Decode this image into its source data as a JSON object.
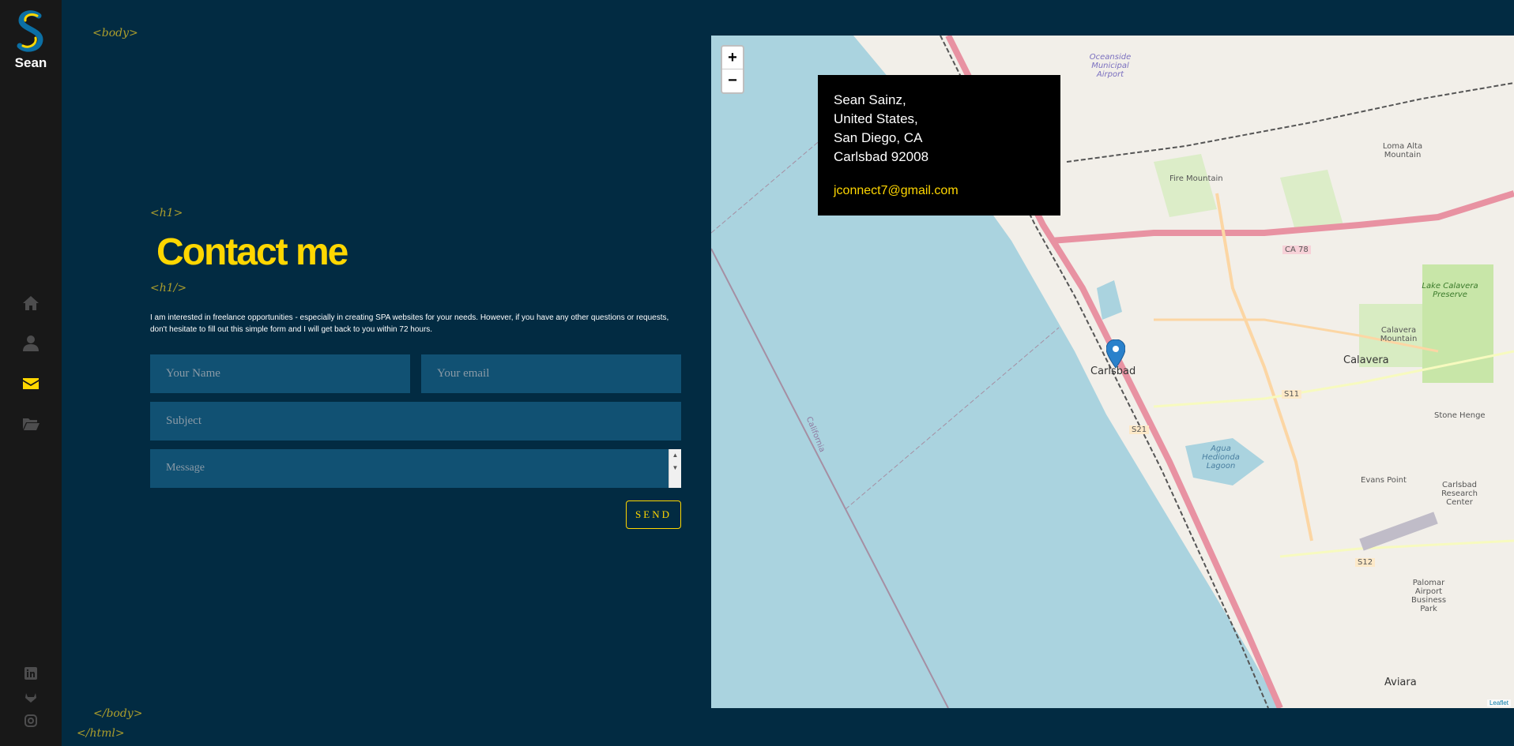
{
  "sidebar": {
    "logo_name": "Sean",
    "nav": [
      "home-icon",
      "user-icon",
      "envelope-icon",
      "folder-icon"
    ],
    "social": [
      "linkedin-icon",
      "gitlab-icon",
      "instagram-icon"
    ]
  },
  "tags": {
    "body_open": "<body>",
    "h1_open": "<h1>",
    "h1_close": "<h1/>",
    "body_close": "</body>",
    "html_close": "</html>"
  },
  "contact": {
    "title": "Contact me",
    "description": "I am interested in freelance opportunities - especially in creating SPA websites for your needs. However, if you have any other questions or requests, don't hesitate to fill out this simple form and I will get back to you within 72 hours.",
    "name_placeholder": "Your Name",
    "email_placeholder": "Your email",
    "subject_placeholder": "Subject",
    "message_placeholder": "Message",
    "send_label": "SEND"
  },
  "map": {
    "zoom_in": "+",
    "zoom_out": "−",
    "info_lines": [
      "Sean Sainz,",
      "United States,",
      "San Diego, CA",
      "Carlsbad 92008"
    ],
    "info_email": "jconnect7@gmail.com",
    "attribution": "Leaflet",
    "labels": {
      "carlsbad": "Carlsbad",
      "calavera": "Calavera",
      "aviara": "Aviara",
      "oceanside_airport": "Oceanside Municipal Airport",
      "fire_mountain": "Fire Mountain",
      "loma_alta": "Loma Alta Mountain",
      "lake_calavera": "Lake Calavera Preserve",
      "calavera_mountain": "Calavera Mountain",
      "stone_henge": "Stone Henge",
      "evans_point": "Evans Point",
      "agua_hedionda": "Agua Hedionda Lagoon",
      "research_center": "Carlsbad Research Center",
      "palomar": "Palomar Airport Business Park",
      "california": "California",
      "ca78": "CA 78",
      "s11": "S11",
      "s12": "S12",
      "s21": "S21"
    }
  },
  "colors": {
    "background": "#022b42",
    "sidebar": "#181818",
    "accent": "#ffd700",
    "field": "#115173"
  }
}
